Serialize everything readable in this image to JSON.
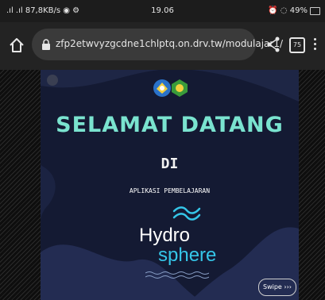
{
  "status_bar": {
    "left": ".ıl .ıl 87,8KB/s ◉ ⚙",
    "time": "19.06",
    "right": "⏰ ◌ 49%",
    "battery_level": 0.49
  },
  "browser": {
    "url": "zfp2etwvyzgcdne1chlptq.on.drv.tw/modulajar1/",
    "tab_count": "75"
  },
  "page": {
    "heading": "SELAMAT DATANG",
    "subheading": "DI",
    "app_label": "APLIKASI PEMBELAJARAN",
    "brand_line1": "Hydro",
    "brand_line2": "sphere",
    "swipe_button": "Swipe ›››"
  },
  "colors": {
    "heading": "#7ae3cf",
    "card_background": "#141a33",
    "accent_blue": "#35c6e8"
  }
}
